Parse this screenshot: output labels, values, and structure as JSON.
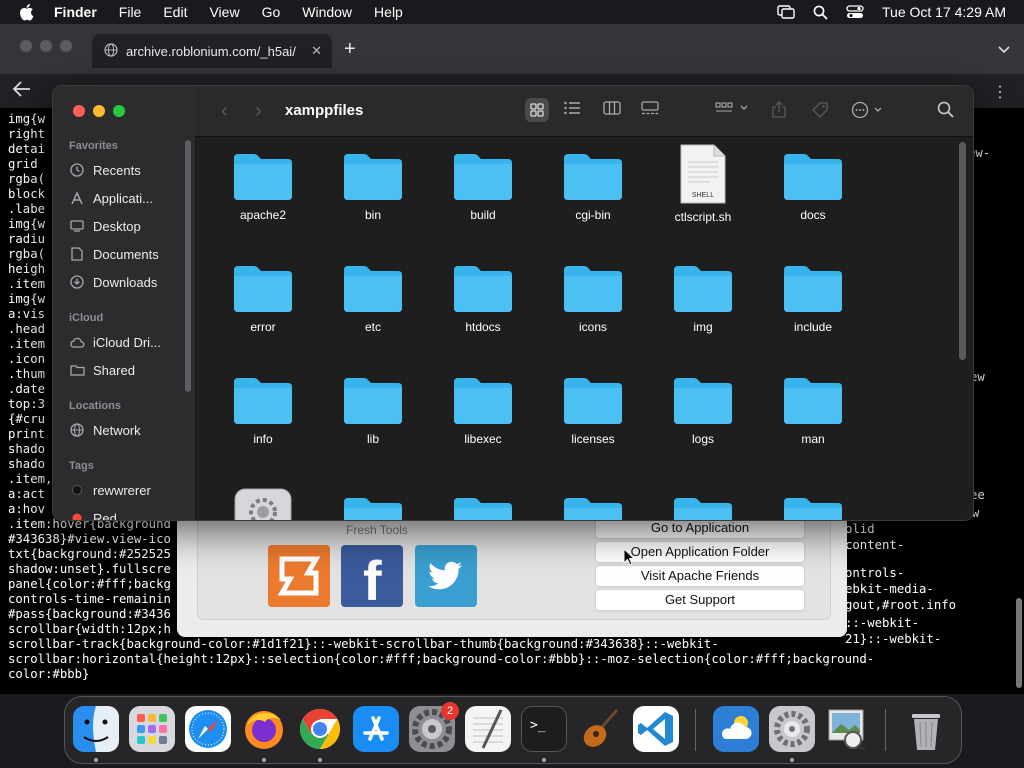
{
  "menubar": {
    "app": "Finder",
    "items": [
      "File",
      "Edit",
      "View",
      "Go",
      "Window",
      "Help"
    ],
    "clock": "Tue Oct 17  4:29 AM"
  },
  "browser": {
    "tab_title": "archive.roblonium.com/_h5ai/",
    "code_lines": [
      "img{w",
      "right",
      "detai",
      "grid ",
      "rgba(",
      "block",
      ".labe",
      "img{w",
      "radiu",
      "rgba(",
      "heigh",
      ".item",
      "img{w",
      "a:vis",
      ".head",
      ".item",
      ".icon",
      ".thum",
      ".date",
      "top:3",
      "{#cru",
      "print",
      "shado",
      "shado",
      ".item,",
      "a:act",
      "a:hov",
      ".item:hover{background",
      "#343638}#view.view-ico",
      "txt{background:#252525",
      "shadow:unset}.fullscre",
      "panel{color:#fff;backg",
      "controls-time-remainin",
      "#pass{background:#3436",
      "scrollbar{width:12px;h",
      "scrollbar-track{background-color:#1d1f21}::-webkit-scrollbar-thumb{background:#343638}::-webkit-",
      "scrollbar:horizontal{height:12px}::selection{color:#fff;background-color:#bbb}::-moz-selection{color:#fff;background-",
      "color:#bbb}"
    ],
    "code_right": [
      "ew-",
      "ew",
      "ee",
      "w",
      "olid",
      "content-",
      "ontrols-",
      "ebkit-media-",
      "gout,#root.info",
      "::-webkit-",
      "21}::-webkit-"
    ]
  },
  "xampp": {
    "section_title": "Fresh Tools",
    "buttons": [
      "Go to Application",
      "Open Application Folder",
      "Visit Apache Friends",
      "Get Support"
    ]
  },
  "finder": {
    "title": "xamppfiles",
    "sidebar": {
      "favorites_label": "Favorites",
      "favorites": [
        "Recents",
        "Applicati...",
        "Desktop",
        "Documents",
        "Downloads"
      ],
      "icloud_label": "iCloud",
      "icloud": [
        "iCloud Dri...",
        "Shared"
      ],
      "locations_label": "Locations",
      "locations": [
        "Network"
      ],
      "tags_label": "Tags",
      "tags": [
        "rewwrerer",
        "Red"
      ]
    },
    "items": [
      "apache2",
      "bin",
      "build",
      "cgi-bin",
      "ctlscript.sh",
      "docs",
      "error",
      "etc",
      "htdocs",
      "icons",
      "img",
      "include",
      "info",
      "lib",
      "libexec",
      "licenses",
      "logs",
      "man"
    ],
    "shell_label": "SHELL"
  },
  "dock": {
    "apps": [
      "Finder",
      "Launchpad",
      "Safari",
      "Firefox",
      "Chrome",
      "App Store",
      "System Settings",
      "TextEdit",
      "Terminal",
      "Instruments",
      "Visual Studio Code",
      "Weather",
      "XAMPP",
      "Preview",
      "Trash"
    ],
    "settings_badge": "2"
  },
  "colors": {
    "folder": "#38b4ec",
    "accent": "#0a84ff"
  }
}
